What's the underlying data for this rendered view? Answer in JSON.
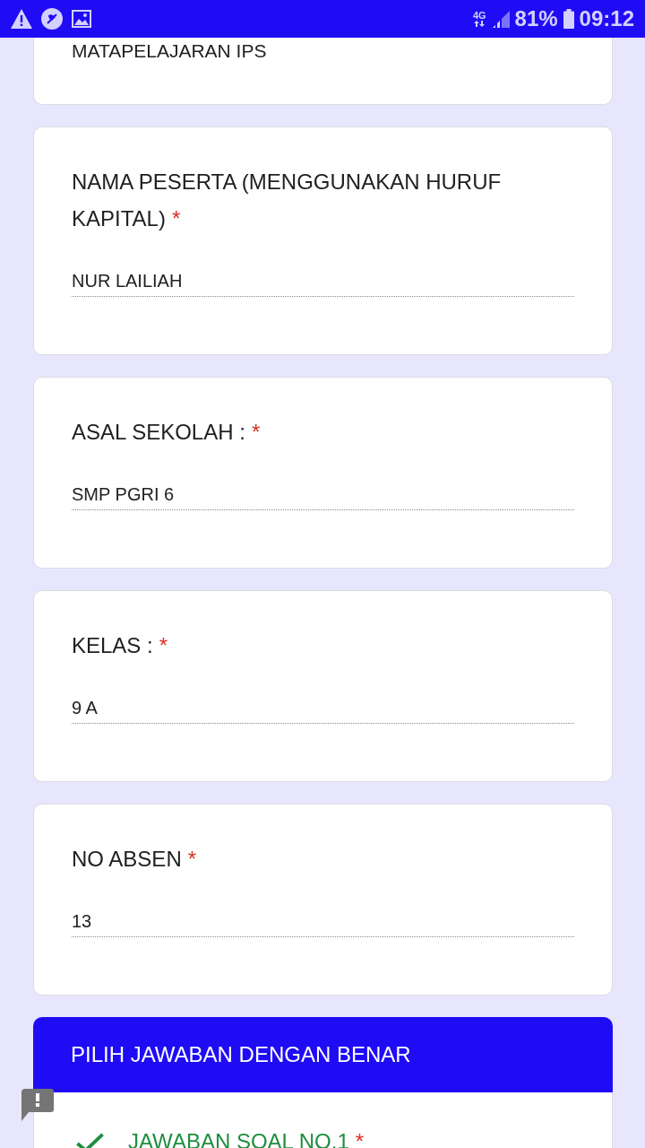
{
  "status_bar": {
    "network": "4G",
    "battery": "81%",
    "time": "09:12"
  },
  "description_card": {
    "text": "MATAPELAJARAN IPS"
  },
  "questions": [
    {
      "title": "NAMA PESERTA (MENGGUNAKAN HURUF KAPITAL)",
      "required_mark": "*",
      "value": "NUR LAILIAH"
    },
    {
      "title": "ASAL SEKOLAH :",
      "required_mark": "*",
      "value": "SMP PGRI 6"
    },
    {
      "title": "KELAS :",
      "required_mark": "*",
      "value": "9 A"
    },
    {
      "title": "NO ABSEN",
      "required_mark": "*",
      "value": "13"
    }
  ],
  "section": {
    "title": "PILIH JAWABAN DENGAN BENAR"
  },
  "graded_question": {
    "title": "JAWABAN SOAL NO.1",
    "required_mark": "*",
    "correct": true
  }
}
